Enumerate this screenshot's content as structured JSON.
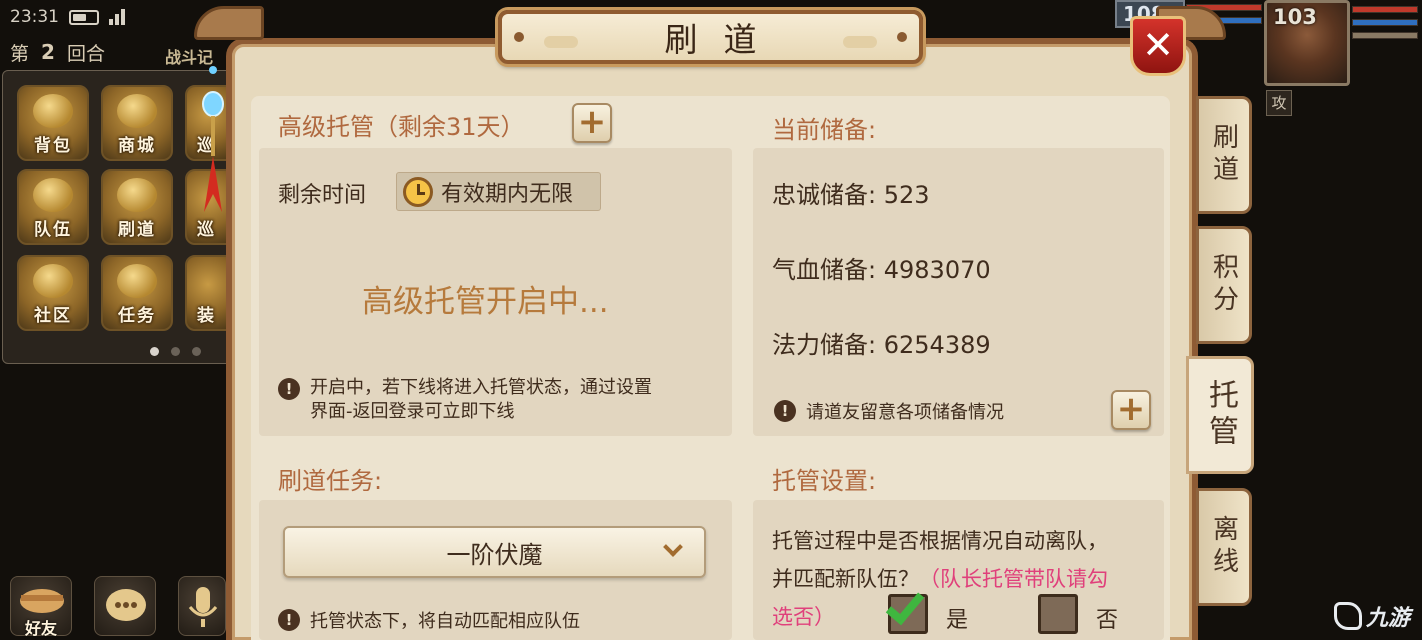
{
  "status_bar": {
    "time": "23:31",
    "battery_level": 0.6
  },
  "hud": {
    "round_prefix": "第",
    "round_number": "2",
    "round_suffix": "回合",
    "battle_log": "战斗记",
    "menu_items": [
      {
        "label": "背包",
        "icon": "bag-icon"
      },
      {
        "label": "商城",
        "icon": "gold-ingot-icon"
      },
      {
        "label": "队伍",
        "icon": "team-flag-icon"
      },
      {
        "label": "刷道",
        "icon": "scroll-icon"
      },
      {
        "label": "社区",
        "icon": "pavilion-icon"
      },
      {
        "label": "任务",
        "icon": "quest-scroll-icon"
      }
    ],
    "menu_partial_labels": [
      "巡",
      "装"
    ],
    "bottom_buttons": [
      {
        "label": "好友",
        "icon": "handshake-icon"
      },
      {
        "label": "",
        "icon": "chat-icon"
      },
      {
        "label": "",
        "icon": "microphone-icon"
      }
    ],
    "enemy_level": "108",
    "player_level": "103",
    "attack_tag": "攻",
    "watermark": "九游"
  },
  "dialog": {
    "title": "刷道",
    "close_icon": "close-icon",
    "hosting": {
      "heading": "高级托管（剩余31天）",
      "remaining_label": "剩余时间",
      "validity": "有效期内无限",
      "status": "高级托管开启中...",
      "notice_line1": "开启中，若下线将进入托管状态，通过设置",
      "notice_line2": "界面-返回登录可立即下线"
    },
    "reserve": {
      "heading": "当前储备:",
      "items": [
        {
          "label": "忠诚储备:",
          "value": "523"
        },
        {
          "label": "气血储备:",
          "value": "4983070"
        },
        {
          "label": "法力储备:",
          "value": "6254389"
        }
      ],
      "notice": "请道友留意各项储备情况"
    },
    "task": {
      "heading": "刷道任务:",
      "selected": "一阶伏魔",
      "notice": "托管状态下，将自动匹配相应队伍"
    },
    "settings": {
      "heading": "托管设置:",
      "question_line1": "托管过程中是否根据情况自动离队，",
      "question_line2": "并匹配新队伍？",
      "hint_line1": "（队长托管带队请勾",
      "hint_line2": "选否）",
      "yes_label": "是",
      "no_label": "否",
      "yes_checked": true,
      "no_checked": false
    }
  },
  "side_tabs": [
    {
      "label": "刷道",
      "active": false
    },
    {
      "label": "积分",
      "active": false
    },
    {
      "label": "托管",
      "active": true
    },
    {
      "label": "离线",
      "active": false
    }
  ],
  "colors": {
    "section_heading": "#b0693f",
    "status_text": "#b67a3c",
    "hint_pink": "#e0407b",
    "checkbox_green": "#3fb63f",
    "close_red": "#c1261f"
  }
}
